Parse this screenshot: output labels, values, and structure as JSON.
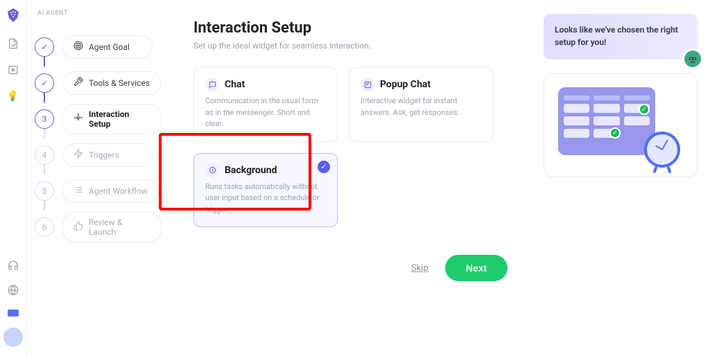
{
  "sidebar": {
    "header": "AI AGENT",
    "steps": [
      {
        "label": "Agent Goal",
        "indicator": "✓"
      },
      {
        "label": "Tools & Services",
        "indicator": "✓"
      },
      {
        "label": "Interaction Setup",
        "indicator": "3"
      },
      {
        "label": "Triggers",
        "indicator": "4"
      },
      {
        "label": "Agent Workflow",
        "indicator": "5"
      },
      {
        "label": "Review & Launch",
        "indicator": "6"
      }
    ]
  },
  "main": {
    "title": "Interaction Setup",
    "subtitle": "Set up the ideal widget for seamless interaction.",
    "cards": {
      "chat": {
        "title": "Chat",
        "desc": "Communication in the usual form as in the messenger. Short and clear."
      },
      "popup": {
        "title": "Popup Chat",
        "desc": "Interactive widget for instant answers. Ask, get responses."
      },
      "background": {
        "title": "Background",
        "desc": "Runs tasks automatically without user input based on a schedule or trigger."
      }
    },
    "skipLabel": "Skip",
    "nextLabel": "Next"
  },
  "panel": {
    "bubbleText": "Looks like we've chosen the right setup for you!"
  }
}
